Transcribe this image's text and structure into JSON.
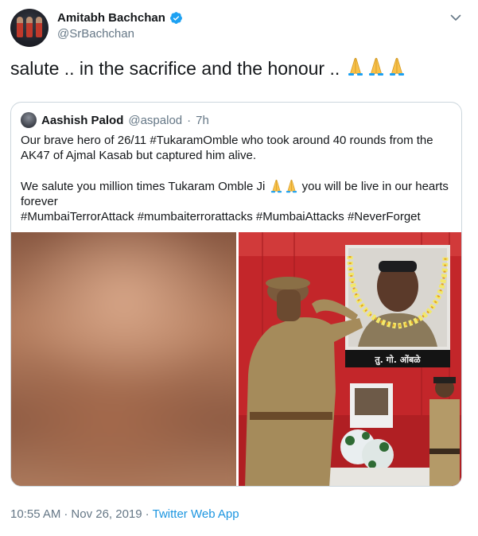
{
  "author": {
    "display_name": "Amitabh Bachchan",
    "handle": "@SrBachchan",
    "verified": true,
    "verified_icon": "verified-badge-icon",
    "avatar_icon": "avatar"
  },
  "tweet": {
    "text": "salute .. in the sacrifice and the honour .. ",
    "emojis": [
      "folded-hands-icon",
      "folded-hands-icon",
      "folded-hands-icon"
    ],
    "menu_icon": "chevron-down-icon"
  },
  "quoted_tweet": {
    "display_name": "Aashish Palod",
    "handle": "@aspalod",
    "separator": "·",
    "time": "7h",
    "paragraph1": "Our brave hero of 26/11 #TukaramOmble who took around 40 rounds from the AK47 of Ajmal Kasab but captured him alive.",
    "paragraph2_start": "We salute you million times Tukaram Omble Ji ",
    "paragraph2_end": " you will be live in our hearts forever",
    "hashtags": "#MumbaiTerrorAttack #mumbaiterrorattacks #MumbaiAttacks #NeverForget",
    "emojis": [
      "folded-hands-icon",
      "folded-hands-icon"
    ],
    "photo_caption": "तु. गो. ओंबळे"
  },
  "footer": {
    "time": "10:55 AM",
    "separator1": "·",
    "date": "Nov 26, 2019",
    "separator2": "·",
    "source": "Twitter Web App"
  },
  "colors": {
    "text": "#14171a",
    "secondary": "#657786",
    "link": "#1b95e0",
    "border": "#ccd6dd",
    "verified": "#1da1f2"
  }
}
